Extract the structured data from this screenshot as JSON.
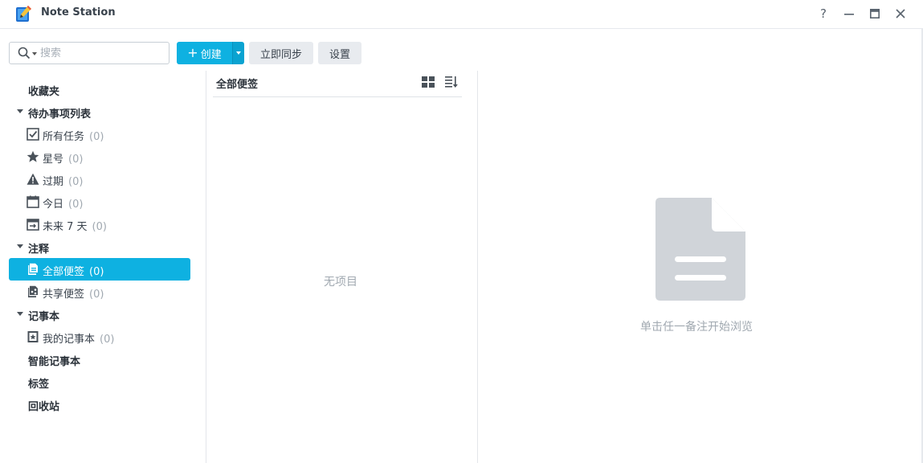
{
  "window": {
    "title": "Note Station",
    "help": "?",
    "minimize": "—",
    "maximize": "▣",
    "close": "✕"
  },
  "toolbar": {
    "search_placeholder": "搜索",
    "create_plus": "+",
    "create_label": "创建",
    "sync_label": "立即同步",
    "settings_label": "设置"
  },
  "sidebar": {
    "favorites": "收藏夹",
    "todo_header": "待办事项列表",
    "todo_items": [
      {
        "label": "所有任务",
        "count": "(0)",
        "icon": "checkbox-icon"
      },
      {
        "label": "星号",
        "count": "(0)",
        "icon": "star-icon"
      },
      {
        "label": "过期",
        "count": "(0)",
        "icon": "warning-icon"
      },
      {
        "label": "今日",
        "count": "(0)",
        "icon": "calendar-today-icon"
      },
      {
        "label": "未来 7 天",
        "count": "(0)",
        "icon": "calendar-week-icon"
      }
    ],
    "notes_header": "注释",
    "notes_items": [
      {
        "label": "全部便签",
        "count": "(0)",
        "icon": "notes-icon",
        "selected": true
      },
      {
        "label": "共享便签",
        "count": "(0)",
        "icon": "shared-notes-icon"
      }
    ],
    "notebooks_header": "记事本",
    "notebook_items": [
      {
        "label": "我的记事本",
        "count": "(0)",
        "icon": "notebook-star-icon"
      }
    ],
    "smart_notebook": "智能记事本",
    "tags": "标签",
    "recycle_bin": "回收站"
  },
  "list": {
    "title": "全部便签",
    "empty": "无项目"
  },
  "preview": {
    "hint": "单击任一备注开始浏览"
  },
  "colors": {
    "accent": "#0eb1e1",
    "muted_text": "#a0a8b0",
    "doc_icon": "#d0d4d9"
  }
}
